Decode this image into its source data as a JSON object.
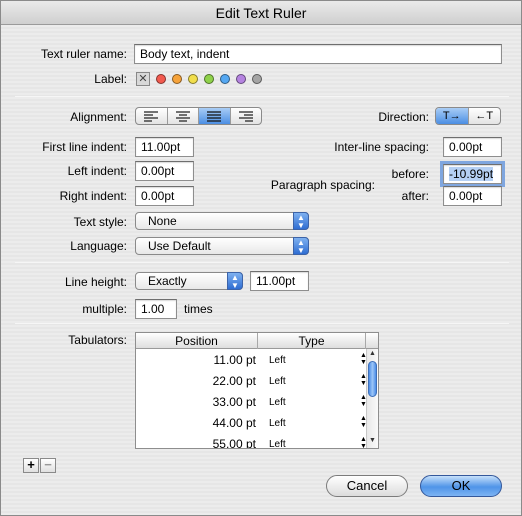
{
  "window": {
    "title": "Edit Text Ruler"
  },
  "name_row": {
    "label": "Text ruler name:",
    "value": "Body text, indent"
  },
  "label_row": {
    "label": "Label:",
    "swatches": [
      {
        "name": "none",
        "color": "#c8c8c8"
      },
      {
        "name": "red",
        "color": "#f25a4f"
      },
      {
        "name": "orange",
        "color": "#f6a33b"
      },
      {
        "name": "yellow",
        "color": "#f1de4c"
      },
      {
        "name": "green",
        "color": "#8fd24a"
      },
      {
        "name": "blue",
        "color": "#55a8f2"
      },
      {
        "name": "purple",
        "color": "#b583e0"
      },
      {
        "name": "gray",
        "color": "#a5a5a5"
      }
    ]
  },
  "alignment": {
    "label": "Alignment:",
    "options": [
      "left",
      "center",
      "justify",
      "right"
    ],
    "selected": "justify"
  },
  "direction": {
    "label": "Direction:",
    "options": [
      "T→",
      "←T"
    ],
    "selected": "T→"
  },
  "indents": {
    "first_line_label": "First line indent:",
    "first_line_value": "11.00pt",
    "left_label": "Left indent:",
    "left_value": "0.00pt",
    "right_label": "Right indent:",
    "right_value": "0.00pt"
  },
  "spacing": {
    "inter_line_label": "Inter-line spacing:",
    "inter_line_value": "0.00pt",
    "paragraph_label": "Paragraph spacing:",
    "before_label": "before:",
    "before_value": "-10.99pt",
    "after_label": "after:",
    "after_value": "0.00pt"
  },
  "text_style": {
    "label": "Text style:",
    "value": "None"
  },
  "language": {
    "label": "Language:",
    "value": "Use Default"
  },
  "line_height": {
    "label": "Line height:",
    "mode": "Exactly",
    "value": "11.00pt"
  },
  "multiple": {
    "label": "multiple:",
    "value": "1.00",
    "suffix": "times"
  },
  "tabulators": {
    "label": "Tabulators:",
    "columns": [
      "Position",
      "Type"
    ],
    "rows": [
      {
        "position": "11.00 pt",
        "type": "Left"
      },
      {
        "position": "22.00 pt",
        "type": "Left"
      },
      {
        "position": "33.00 pt",
        "type": "Left"
      },
      {
        "position": "44.00 pt",
        "type": "Left"
      },
      {
        "position": "55.00 pt",
        "type": "Left"
      }
    ]
  },
  "add_symbol": "+",
  "remove_symbol": "−",
  "buttons": {
    "cancel": "Cancel",
    "ok": "OK"
  },
  "colors": {
    "accent": "#4f94e8"
  }
}
